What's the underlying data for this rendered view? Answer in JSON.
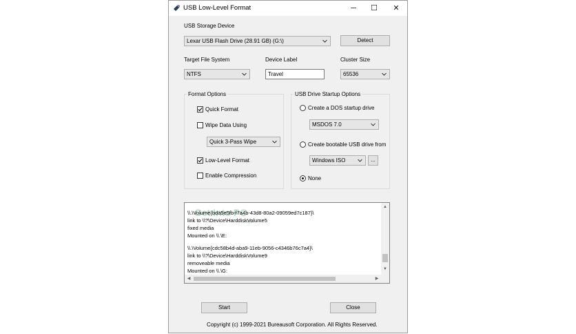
{
  "window": {
    "title": "USB Low-Level Format",
    "controls": {
      "minimize": "─",
      "maximize": "☐",
      "close": "✕"
    }
  },
  "device": {
    "label": "USB Storage Device",
    "selected": "Lexar USB Flash Drive (28.91 GB) (G:\\)",
    "detect_button": "Detect"
  },
  "file_system": {
    "label": "Target File System",
    "selected": "NTFS"
  },
  "device_label": {
    "label": "Device Label",
    "value": "Travel"
  },
  "cluster_size": {
    "label": "Cluster Size",
    "selected": "65536"
  },
  "format_options": {
    "title": "Format Options",
    "quick_format": {
      "label": "Quick Format",
      "checked": true
    },
    "wipe_data": {
      "label": "Wipe Data Using",
      "checked": false
    },
    "wipe_method": "Quick 3-Pass Wipe",
    "low_level": {
      "label": "Low-Level Format",
      "checked": true
    },
    "compression": {
      "label": "Enable Compression",
      "checked": false
    }
  },
  "startup_options": {
    "title": "USB Drive Startup Options",
    "dos": {
      "label": "Create a DOS startup drive",
      "selected": false
    },
    "dos_version": "MSDOS 7.0",
    "bootable": {
      "label": "Create bootable USB drive from",
      "selected": false
    },
    "bootable_source": "Windows ISO",
    "browse_button": "...",
    "none": {
      "label": "None",
      "selected": true
    }
  },
  "log": {
    "lines": [
      "\\\\.\\Volume{bda5e5fb-f7a4b-43d8-80a2-09059ed7c187}\\",
      "  link to \\\\?\\Device\\HarddiskVolume5",
      "  fixed media",
      "  Mounted on \\\\.\\E:",
      "",
      "\\\\.\\Volume{cdc58b4d-aba9-11eb-9056-c4346b76c7a4}\\",
      "  link to \\\\?\\Device\\HarddiskVolume9",
      "  removeable media",
      "  Mounted on \\\\.\\G:"
    ],
    "watermark": "Get Into PC",
    "watermark_sub": ".com"
  },
  "buttons": {
    "start": "Start",
    "close": "Close"
  },
  "copyright": "Copyright (c) 1999-2021 Bureausoft Corporation. All Rights Reserved."
}
